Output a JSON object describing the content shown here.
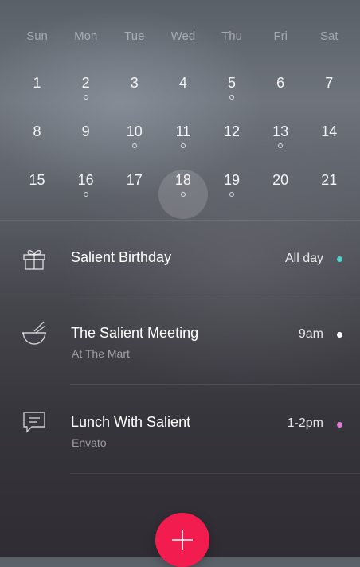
{
  "calendar": {
    "weekdays": [
      "Sun",
      "Mon",
      "Tue",
      "Wed",
      "Thu",
      "Fri",
      "Sat"
    ],
    "weeks": [
      [
        {
          "day": "1",
          "has_event": false
        },
        {
          "day": "2",
          "has_event": true
        },
        {
          "day": "3",
          "has_event": false
        },
        {
          "day": "4",
          "has_event": false
        },
        {
          "day": "5",
          "has_event": true
        },
        {
          "day": "6",
          "has_event": false
        },
        {
          "day": "7",
          "has_event": false
        }
      ],
      [
        {
          "day": "8",
          "has_event": false
        },
        {
          "day": "9",
          "has_event": false
        },
        {
          "day": "10",
          "has_event": true
        },
        {
          "day": "11",
          "has_event": true
        },
        {
          "day": "12",
          "has_event": false
        },
        {
          "day": "13",
          "has_event": true
        },
        {
          "day": "14",
          "has_event": false
        }
      ],
      [
        {
          "day": "15",
          "has_event": false
        },
        {
          "day": "16",
          "has_event": true
        },
        {
          "day": "17",
          "has_event": false
        },
        {
          "day": "18",
          "has_event": true,
          "selected": true
        },
        {
          "day": "19",
          "has_event": true
        },
        {
          "day": "20",
          "has_event": false
        },
        {
          "day": "21",
          "has_event": false
        }
      ]
    ]
  },
  "events": [
    {
      "icon": "gift-icon",
      "title": "Salient Birthday",
      "subtitle": "",
      "time": "All day",
      "color": "#4fd1c5"
    },
    {
      "icon": "bowl-chopsticks-icon",
      "title": "The Salient Meeting",
      "subtitle": "At The Mart",
      "time": "9am",
      "color": "#ffffff"
    },
    {
      "icon": "chat-bubble-icon",
      "title": "Lunch With Salient",
      "subtitle": "Envato",
      "time": "1-2pm",
      "color": "#e07ad6"
    }
  ],
  "colors": {
    "accent": "#f31c4f"
  },
  "fab": {
    "icon": "plus-icon"
  }
}
